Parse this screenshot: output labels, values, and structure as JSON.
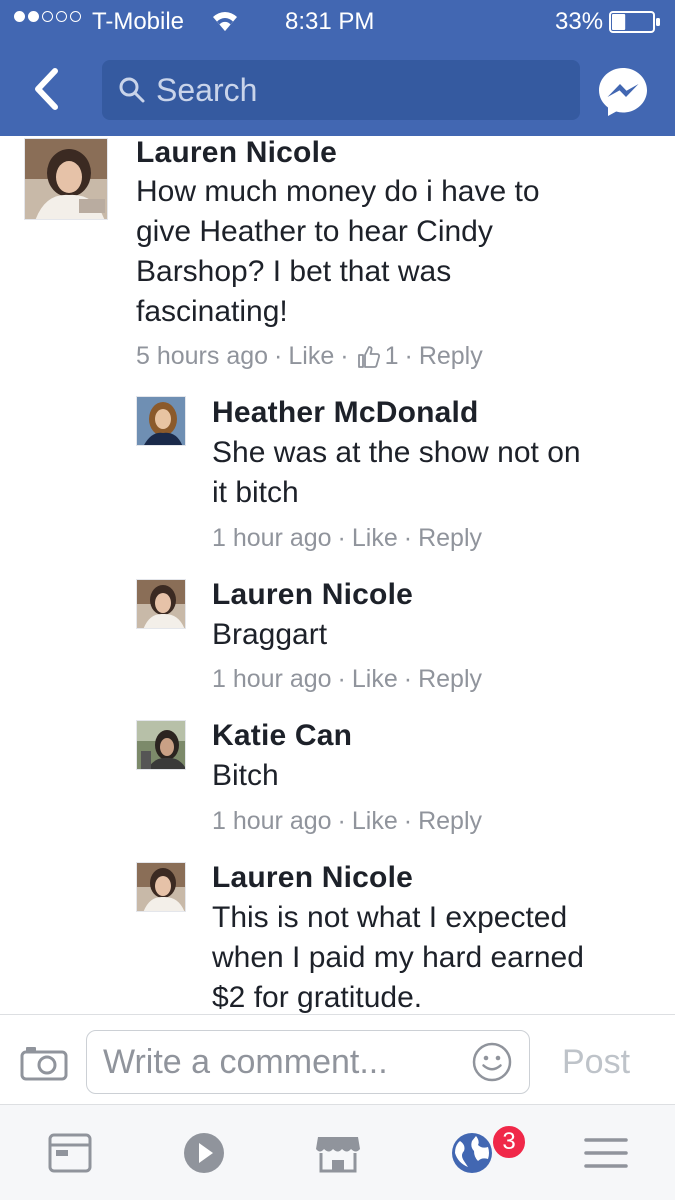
{
  "status_bar": {
    "carrier": "T-Mobile",
    "time": "8:31 PM",
    "battery_percent": "33%",
    "signal_bars_filled": 2,
    "signal_bars_total": 5,
    "battery_level": 0.33
  },
  "header": {
    "search_placeholder": "Search",
    "background_color": "#4267b2"
  },
  "comment": {
    "author": "Lauren Nicole",
    "lines": [
      "How much money do i have to",
      "give Heather to hear Cindy",
      "Barshop? I bet that was",
      "fascinating!"
    ],
    "time": "5 hours ago",
    "like_label": "Like",
    "like_count": "1",
    "reply_label": "Reply"
  },
  "replies": [
    {
      "author": "Heather McDonald",
      "lines": [
        "She was at the show not on",
        "it bitch"
      ],
      "time": "1 hour ago",
      "like_label": "Like",
      "reply_label": "Reply"
    },
    {
      "author": "Lauren Nicole",
      "lines": [
        "Braggart"
      ],
      "time": "1 hour ago",
      "like_label": "Like",
      "reply_label": "Reply"
    },
    {
      "author": "Katie Can",
      "lines": [
        "Bitch"
      ],
      "time": "1 hour ago",
      "like_label": "Like",
      "reply_label": "Reply"
    },
    {
      "author": "Lauren Nicole",
      "lines": [
        "This is not what I expected",
        "when I paid my hard earned",
        "$2 for gratitude."
      ]
    }
  ],
  "composer": {
    "placeholder": "Write a comment...",
    "post_label": "Post"
  },
  "tabbar": {
    "notifications_badge": "3",
    "accent_color": "#4267b2"
  },
  "separator": "·"
}
